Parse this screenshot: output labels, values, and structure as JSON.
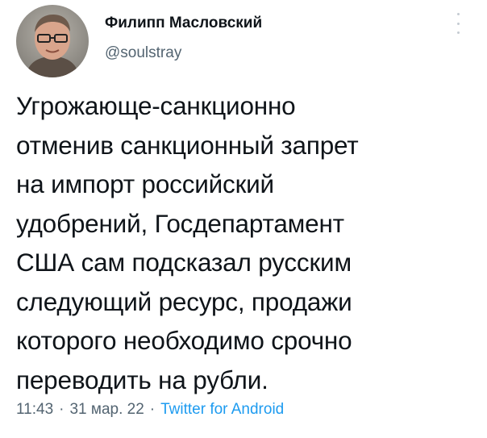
{
  "author": {
    "display_name": "Филипп Масловский",
    "handle": "@soulstray",
    "avatar_icon": "user-avatar"
  },
  "menu": {
    "icon": "more-options-icon"
  },
  "tweet": {
    "lines": [
      "Угрожающе-санкционно",
      "отменив санкционный запрет",
      "на импорт российский",
      "удобрений, Госдепартамент",
      "США сам подсказал русским",
      "следующий ресурс, продажи",
      "которого необходимо срочно",
      "переводить на рубли."
    ]
  },
  "meta": {
    "time": "11:43",
    "separator": "·",
    "date": "31 мар. 22",
    "source": "Twitter for Android"
  },
  "colors": {
    "text": "#0f1419",
    "secondary": "#536471",
    "link": "#1d9bf0"
  }
}
